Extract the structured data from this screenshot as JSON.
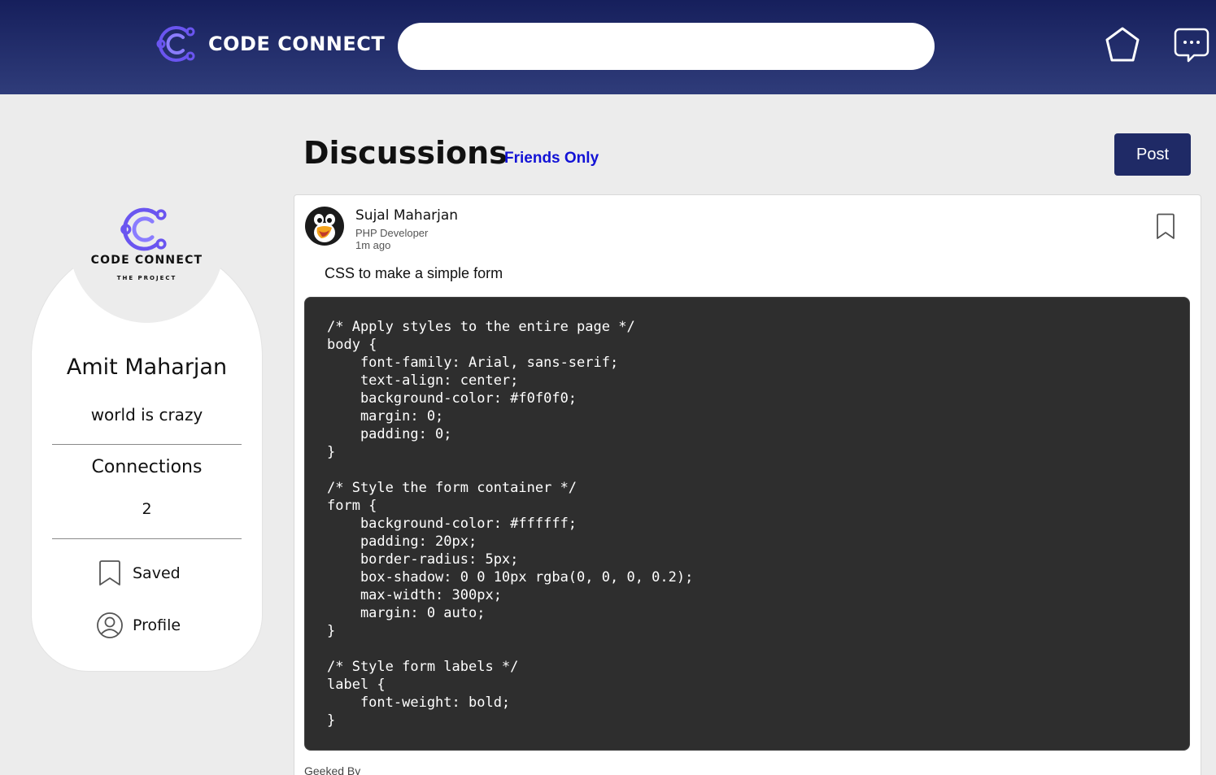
{
  "header": {
    "brand_name": "CODE CONNECT",
    "search_placeholder": "",
    "icons": [
      "code-connect-logo-icon",
      "home-icon",
      "chat-icon"
    ],
    "colors": {
      "header_top": "#161f5c",
      "header_bottom": "#2f3c7a",
      "logo_accent": "#6a55f0"
    }
  },
  "sidebar": {
    "avatar_brand": "CODE CONNECT",
    "avatar_subtitle": "THE PROJECT",
    "user_name": "Amit Maharjan",
    "bio": "world is crazy",
    "connections_label": "Connections",
    "connections_count": "2",
    "menu": [
      {
        "label": "Saved",
        "icon": "bookmark-icon"
      },
      {
        "label": "Profile",
        "icon": "user-icon"
      }
    ]
  },
  "main": {
    "title": "Discussions",
    "filter": "Friends Only",
    "post_button": "Post",
    "colors": {
      "post_button": "#1f2a66",
      "filter_text": "#1212d6",
      "code_bg": "#2e2e2e"
    }
  },
  "post": {
    "author_name": "Sujal Maharjan",
    "author_role": "PHP Developer",
    "time": "1m ago",
    "caption": "CSS to make a simple form",
    "code": "/* Apply styles to the entire page */\nbody {\n    font-family: Arial, sans-serif;\n    text-align: center;\n    background-color: #f0f0f0;\n    margin: 0;\n    padding: 0;\n}\n\n/* Style the form container */\nform {\n    background-color: #ffffff;\n    padding: 20px;\n    border-radius: 5px;\n    box-shadow: 0 0 10px rgba(0, 0, 0, 0.2);\n    max-width: 300px;\n    margin: 0 auto;\n}\n\n/* Style form labels */\nlabel {\n    font-weight: bold;\n}",
    "footer": "Geeked By"
  }
}
